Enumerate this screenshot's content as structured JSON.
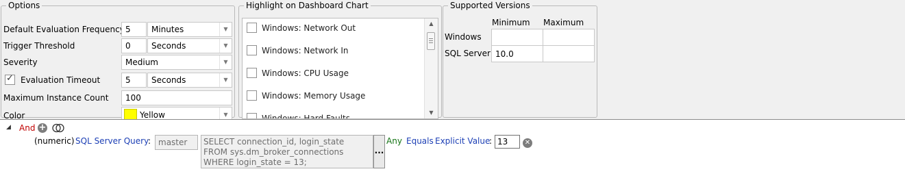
{
  "options": {
    "legend": "Options",
    "eval_frequency": {
      "label": "Default Evaluation Frequency",
      "value": "5",
      "unit": "Minutes"
    },
    "trigger_threshold": {
      "label": "Trigger Threshold",
      "value": "0",
      "unit": "Seconds"
    },
    "severity": {
      "label": "Severity",
      "value": "Medium"
    },
    "eval_timeout": {
      "label": "Evaluation Timeout",
      "checked": true,
      "value": "5",
      "unit": "Seconds"
    },
    "max_instance_count": {
      "label": "Maximum Instance Count",
      "value": "100"
    },
    "color": {
      "label": "Color",
      "value": "Yellow",
      "swatch": "#ffff00"
    }
  },
  "highlight": {
    "legend": "Highlight on Dashboard Chart",
    "items": [
      {
        "label": "Windows: Network Out",
        "checked": false
      },
      {
        "label": "Windows: Network In",
        "checked": false
      },
      {
        "label": "Windows: CPU Usage",
        "checked": false
      },
      {
        "label": "Windows: Memory Usage",
        "checked": false
      },
      {
        "label": "Windows: Hard Faults",
        "checked": false
      }
    ]
  },
  "versions": {
    "legend": "Supported Versions",
    "col_min": "Minimum",
    "col_max": "Maximum",
    "rows": [
      {
        "label": "Windows",
        "min": "",
        "max": ""
      },
      {
        "label": "SQL Server",
        "min": "10.0",
        "max": ""
      }
    ]
  },
  "condition": {
    "operator": "And",
    "type": "(numeric)",
    "source": "SQL Server Query",
    "colon1": ":",
    "database": "master",
    "query": "SELECT connection_id, login_state\nFROM sys.dm_broker_connections\nWHERE login_state = 13;",
    "ellipsis": "...",
    "quantifier": "Any",
    "comparison": "Equals",
    "value_type": "Explicit Value",
    "colon2": ":",
    "value": "13"
  },
  "colors": {
    "and": "#c00000",
    "link_blue": "#1c3fb5",
    "any_green": "#137313",
    "swatch_yellow": "#ffff00"
  }
}
